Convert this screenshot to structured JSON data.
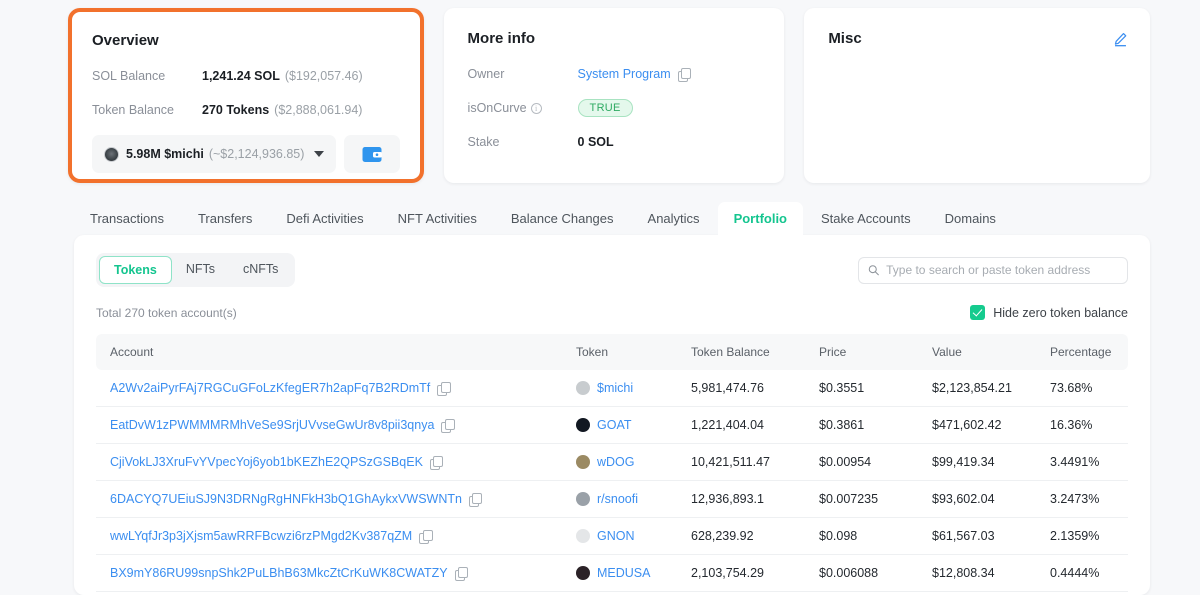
{
  "overview": {
    "title": "Overview",
    "sol_balance_label": "SOL Balance",
    "sol_balance_value": "1,241.24 SOL",
    "sol_balance_usd": "($192,057.46)",
    "token_balance_label": "Token Balance",
    "token_balance_value": "270 Tokens",
    "token_balance_usd": "($2,888,061.94)",
    "token_select_amount": "5.98M $michi",
    "token_select_usd": "(~$2,124,936.85)",
    "highlight_color": "#f2712c"
  },
  "more_info": {
    "title": "More info",
    "owner_label": "Owner",
    "owner_value": "System Program",
    "isoncurve_label": "isOnCurve",
    "isoncurve_value": "TRUE",
    "stake_label": "Stake",
    "stake_value": "0 SOL"
  },
  "misc": {
    "title": "Misc"
  },
  "tabs": [
    {
      "label": "Transactions",
      "active": false
    },
    {
      "label": "Transfers",
      "active": false
    },
    {
      "label": "Defi Activities",
      "active": false
    },
    {
      "label": "NFT Activities",
      "active": false
    },
    {
      "label": "Balance Changes",
      "active": false
    },
    {
      "label": "Analytics",
      "active": false
    },
    {
      "label": "Portfolio",
      "active": true
    },
    {
      "label": "Stake Accounts",
      "active": false
    },
    {
      "label": "Domains",
      "active": false
    }
  ],
  "portfolio": {
    "segments": [
      {
        "label": "Tokens",
        "active": true
      },
      {
        "label": "NFTs",
        "active": false
      },
      {
        "label": "cNFTs",
        "active": false
      }
    ],
    "search_placeholder": "Type to search or paste token address",
    "total_text": "Total 270 token account(s)",
    "hide_zero_label": "Hide zero token balance",
    "hide_zero_checked": true,
    "accent_color": "#14c58f",
    "columns": [
      "Account",
      "Token",
      "Token Balance",
      "Price",
      "Value",
      "Percentage"
    ],
    "rows": [
      {
        "account": "A2Wv2aiPyrFAj7RGCuGFoLzKfegER7h2apFq7B2RDmTf",
        "token": "$michi",
        "token_icon_color": "#c8cccf",
        "balance": "5,981,474.76",
        "price": "$0.3551",
        "value": "$2,123,854.21",
        "percentage": "73.68%"
      },
      {
        "account": "EatDvW1zPWMMMRMhVeSe9SrjUVvseGwUr8v8pii3qnya",
        "token": "GOAT",
        "token_icon_color": "#121822",
        "balance": "1,221,404.04",
        "price": "$0.3861",
        "value": "$471,602.42",
        "percentage": "16.36%"
      },
      {
        "account": "CjiVokLJ3XruFvYVpecYoj6yob1bKEZhE2QPSzGSBqEK",
        "token": "wDOG",
        "token_icon_color": "#9b8a63",
        "balance": "10,421,511.47",
        "price": "$0.00954",
        "value": "$99,419.34",
        "percentage": "3.4491%"
      },
      {
        "account": "6DACYQ7UEiuSJ9N3DRNgRgHNFkH3bQ1GhAykxVWSWNTn",
        "token": "r/snoofi",
        "token_icon_color": "#9aa1a8",
        "balance": "12,936,893.1",
        "price": "$0.007235",
        "value": "$93,602.04",
        "percentage": "3.2473%"
      },
      {
        "account": "wwLYqfJr3p3jXjsm5awRRFBcwzi6rzPMgd2Kv387qZM",
        "token": "GNON",
        "token_icon_color": "#e4e6e8",
        "balance": "628,239.92",
        "price": "$0.098",
        "value": "$61,567.03",
        "percentage": "2.1359%"
      },
      {
        "account": "BX9mY86RU99snpShk2PuLBhB63MkcZtCrKuWK8CWATZY",
        "token": "MEDUSA",
        "token_icon_color": "#2b2227",
        "balance": "2,103,754.29",
        "price": "$0.006088",
        "value": "$12,808.34",
        "percentage": "0.4444%"
      }
    ]
  }
}
